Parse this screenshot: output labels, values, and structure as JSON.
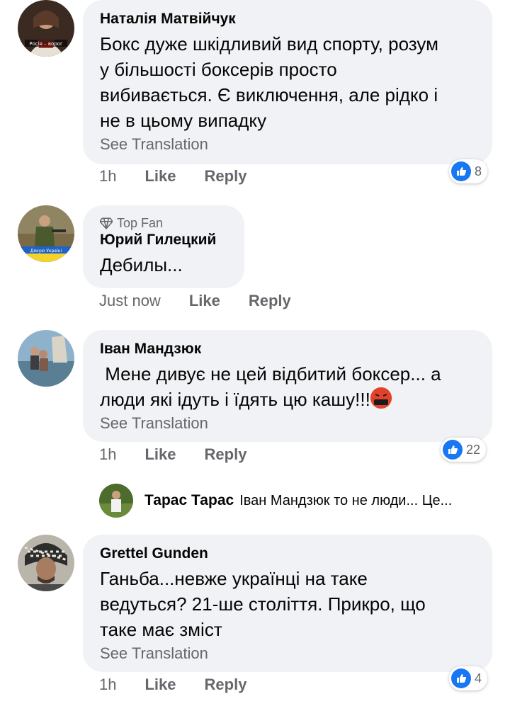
{
  "comments": [
    {
      "author": "Наталія Матвійчук",
      "text_lines": [
        "Бокс дуже шкідливий вид спорту, розум",
        "у більшості боксерів просто",
        "вибивається. Є виключення, але рідко і",
        "не в цьому випадку"
      ],
      "see_translation": "See Translation",
      "time": "1h",
      "like": "Like",
      "reply": "Reply",
      "reaction_count": "8",
      "avatar_caption": "Росія – ворог"
    },
    {
      "badge": "Top Fan",
      "author": "Юрий Гилецкий",
      "text_lines": [
        "Дебилы..."
      ],
      "time": "Just now",
      "like": "Like",
      "reply": "Reply",
      "avatar_caption": "Дякую Україні"
    },
    {
      "author": "Іван Мандзюк",
      "text_lines": [
        " Мене дивує не цей відбитий боксер... а",
        "люди які ідуть і їдять цю кашу!!!"
      ],
      "emoji": "angry-cursing-emoji",
      "see_translation": "See Translation",
      "time": "1h",
      "like": "Like",
      "reply": "Reply",
      "reaction_count": "22"
    },
    {
      "author": "Grettel Gunden",
      "text_lines": [
        "Ганьба...невже українці на таке",
        "ведуться? 21-ше століття. Прикро, що",
        "таке має зміст"
      ],
      "see_translation": "See Translation",
      "time": "1h",
      "like": "Like",
      "reply": "Reply",
      "reaction_count": "4"
    }
  ],
  "reply_preview": {
    "author": "Тарас Тарас",
    "text": "Іван Мандзюк то не люди... Це..."
  },
  "colors": {
    "bubble": "#f0f2f5",
    "secondary_text": "#65676b",
    "like_blue": "#1877f2"
  }
}
